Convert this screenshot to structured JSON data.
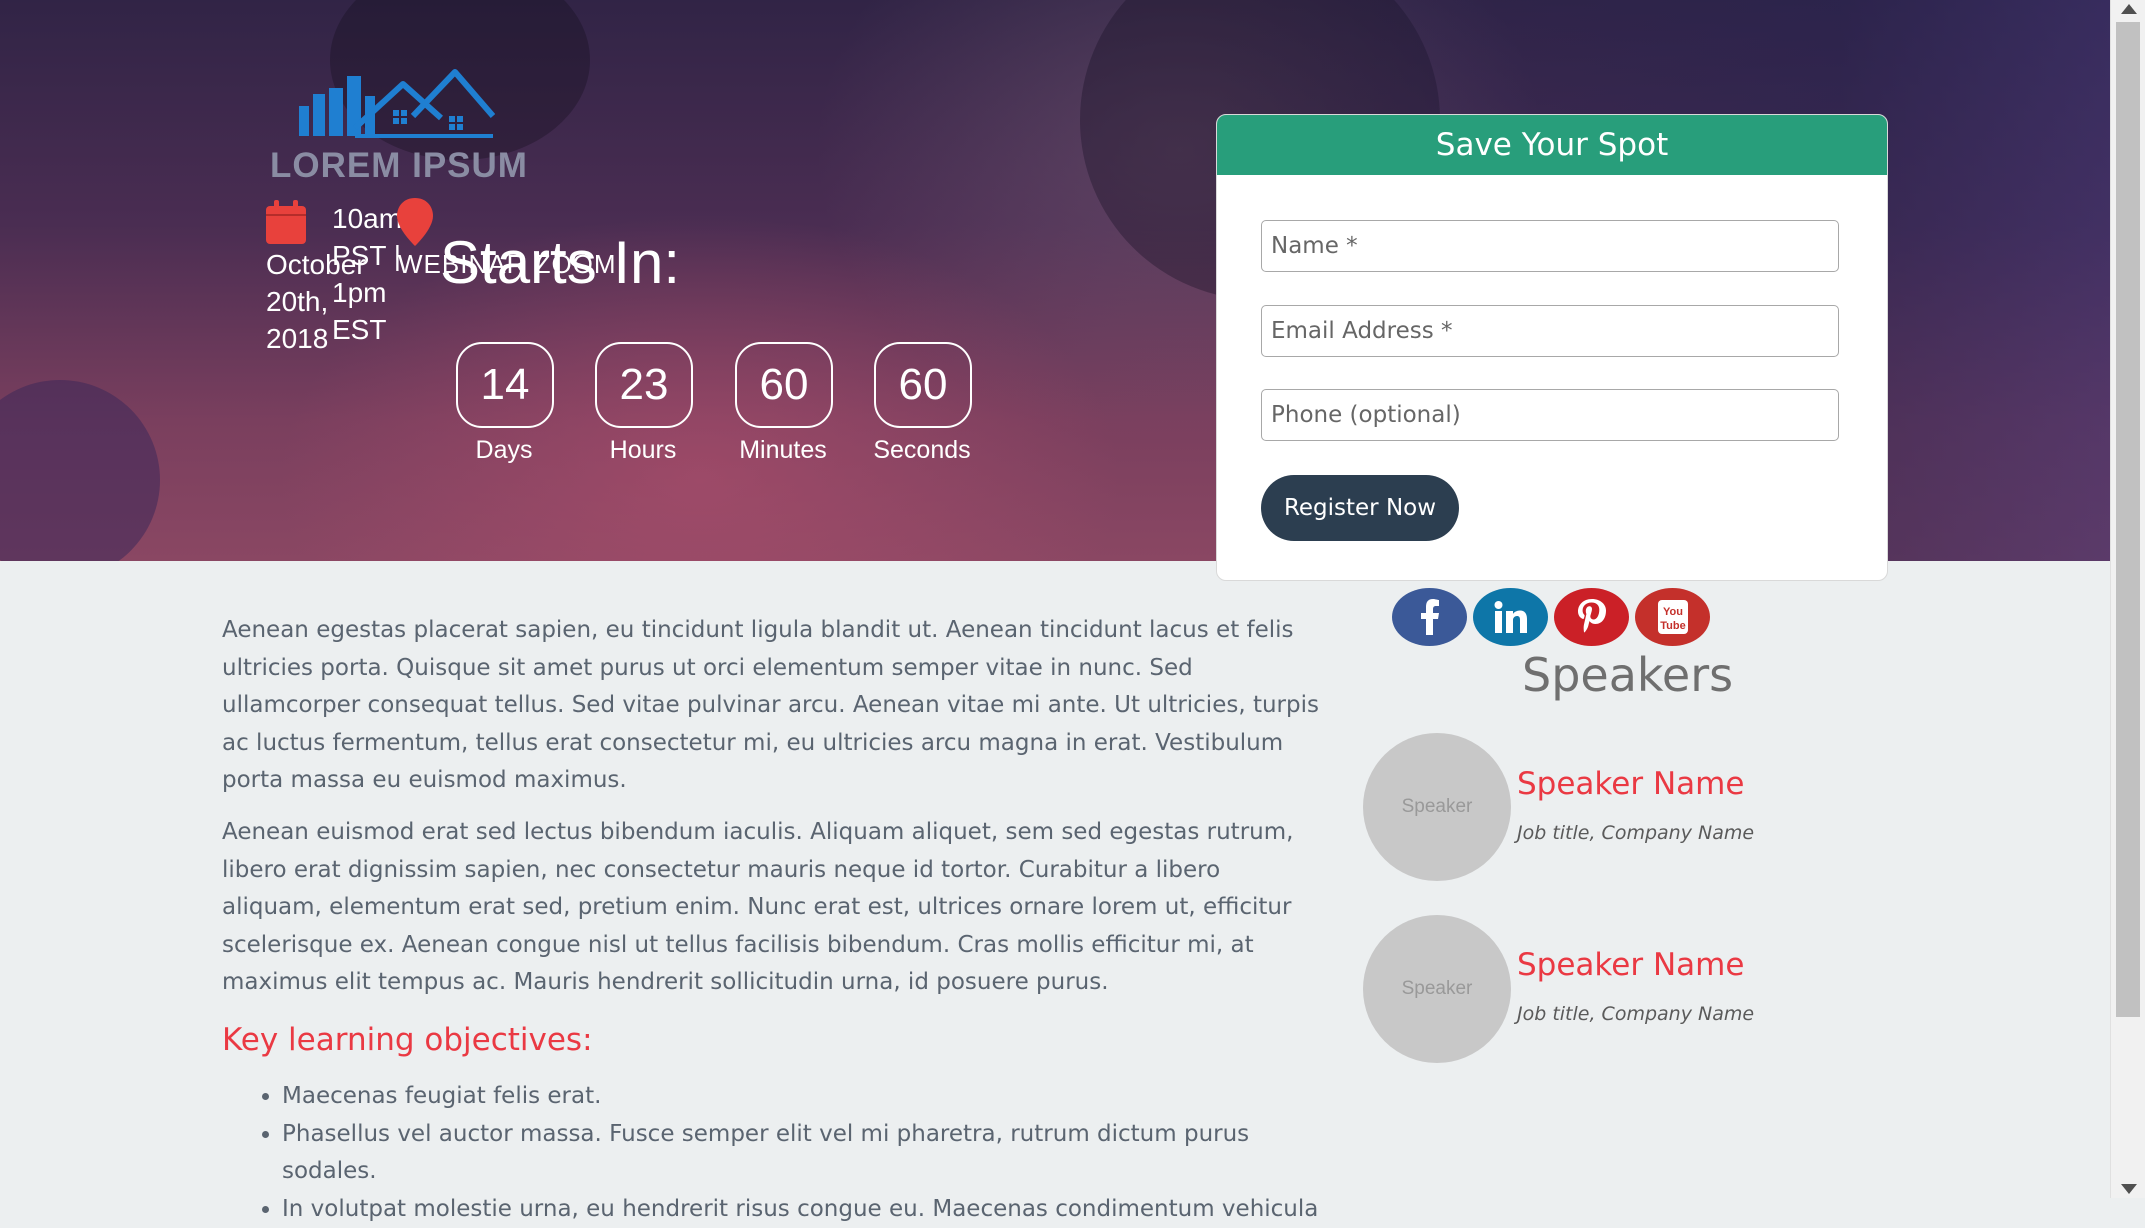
{
  "brand": {
    "logo_text": "LOREM IPSUM"
  },
  "event": {
    "date_text": "October 20th, 2018",
    "time_text": "10am PST | 1pm EST",
    "location_text": "WEBINAR ZOOM"
  },
  "countdown": {
    "heading": "Starts In:",
    "units": [
      {
        "value": "14",
        "label": "Days"
      },
      {
        "value": "23",
        "label": "Hours"
      },
      {
        "value": "60",
        "label": "Minutes"
      },
      {
        "value": "60",
        "label": "Seconds"
      }
    ]
  },
  "form": {
    "title": "Save Your Spot",
    "name_placeholder": "Name *",
    "email_placeholder": "Email Address *",
    "phone_placeholder": "Phone (optional)",
    "submit_label": "Register Now"
  },
  "social": [
    {
      "name": "facebook",
      "color": "#3b5998"
    },
    {
      "name": "linkedin",
      "color": "#0e76a8"
    },
    {
      "name": "pinterest",
      "color": "#cb2027"
    },
    {
      "name": "youtube",
      "color": "#c4302b"
    }
  ],
  "content": {
    "paragraph_1": "Aenean egestas placerat sapien, eu tincidunt ligula blandit ut. Aenean tincidunt lacus et felis ultricies porta. Quisque sit amet purus ut orci elementum semper vitae in nunc. Sed ullamcorper consequat tellus. Sed vitae pulvinar arcu. Aenean vitae mi ante. Ut ultricies, turpis ac luctus fermentum, tellus erat consectetur mi, eu ultricies arcu magna in erat. Vestibulum porta massa eu euismod maximus.",
    "paragraph_2": "Aenean euismod erat sed lectus bibendum iaculis. Aliquam aliquet, sem sed egestas rutrum, libero erat dignissim sapien, nec consectetur mauris neque id tortor. Curabitur a libero aliquam, elementum erat sed, pretium enim. Nunc erat est, ultrices ornare lorem ut, efficitur scelerisque ex. Aenean congue nisl ut tellus facilisis bibendum. Cras mollis efficitur mi, at maximus elit tempus ac. Mauris hendrerit sollicitudin urna, id posuere purus.",
    "objectives_title": "Key learning objectives:",
    "objectives": [
      "Maecenas feugiat felis erat.",
      "Phasellus vel auctor massa. Fusce semper elit vel mi pharetra, rutrum dictum purus sodales.",
      "In volutpat molestie urna, eu hendrerit risus congue eu. Maecenas condimentum vehicula"
    ]
  },
  "speakers": {
    "title": "Speakers",
    "items": [
      {
        "avatar_text": "Speaker",
        "name": "Speaker Name",
        "job": "Job title, Company Name"
      },
      {
        "avatar_text": "Speaker",
        "name": "Speaker Name",
        "job": "Job title, Company Name"
      }
    ]
  },
  "colors": {
    "accent_green": "#289e7b",
    "accent_red": "#ea3943",
    "button_dark": "#2c3e50"
  }
}
